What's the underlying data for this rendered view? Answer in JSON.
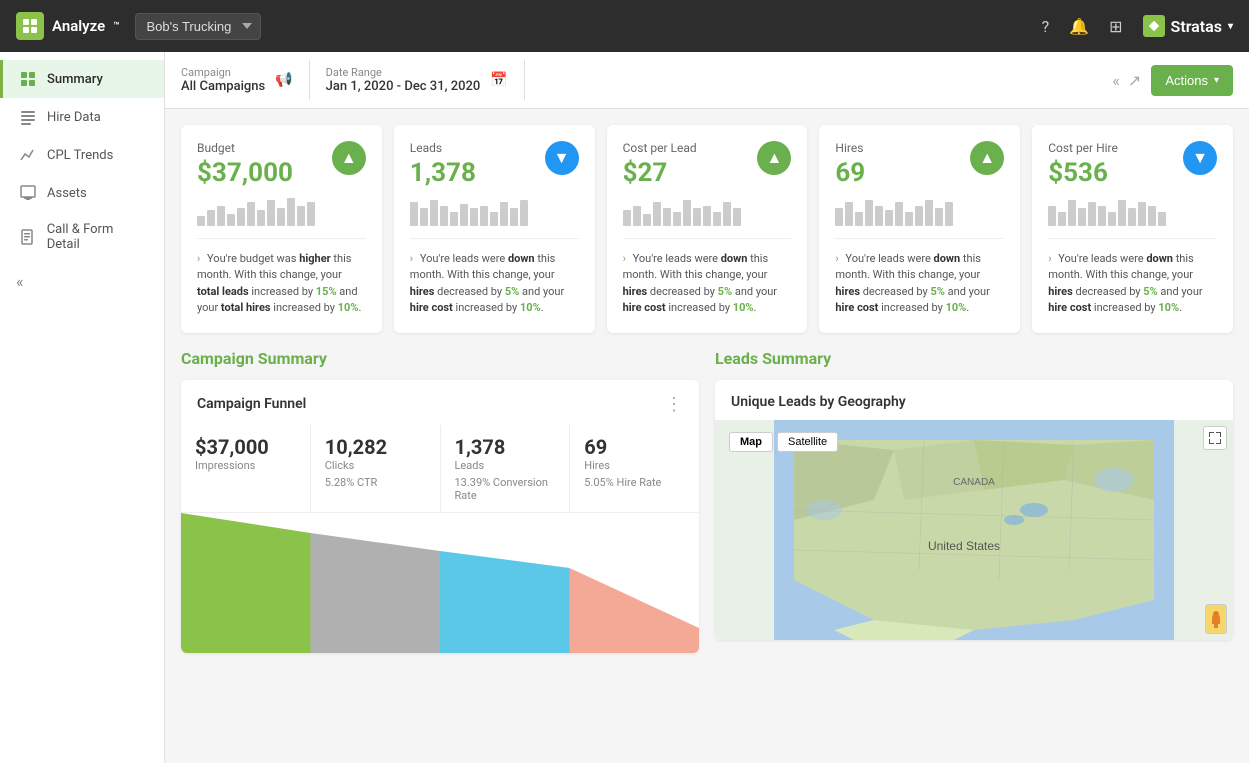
{
  "app": {
    "name": "Analyze",
    "trademark": "™"
  },
  "topnav": {
    "company": "Bob's Trucking",
    "help_icon": "?",
    "bell_icon": "🔔",
    "grid_icon": "⊞",
    "brand": "Stratas",
    "brand_chevron": "▾"
  },
  "sidebar": {
    "items": [
      {
        "id": "summary",
        "label": "Summary",
        "icon": "grid",
        "active": true
      },
      {
        "id": "hire-data",
        "label": "Hire Data",
        "icon": "table",
        "active": false
      },
      {
        "id": "cpl-trends",
        "label": "CPL Trends",
        "icon": "chart",
        "active": false
      },
      {
        "id": "assets",
        "label": "Assets",
        "icon": "image",
        "active": false
      },
      {
        "id": "call-form",
        "label": "Call & Form Detail",
        "icon": "list",
        "active": false
      }
    ],
    "collapse_label": "«"
  },
  "header": {
    "campaign_label": "Campaign",
    "campaign_value": "All Campaigns",
    "campaign_icon": "📢",
    "date_range_label": "Date Range",
    "date_range_value": "Jan 1, 2020 - Dec 31, 2020",
    "date_icon": "📅",
    "actions_label": "Actions",
    "actions_chevron": "▾"
  },
  "metrics": [
    {
      "id": "budget",
      "label": "Budget",
      "value": "$37,000",
      "direction": "up",
      "bars": [
        3,
        5,
        7,
        4,
        6,
        8,
        5,
        9,
        6,
        10,
        7,
        8
      ],
      "insight": "You're budget was higher this month. With this change, your total leads increased by 15% and your total hires increased by 10%."
    },
    {
      "id": "leads",
      "label": "Leads",
      "value": "1,378",
      "direction": "down",
      "bars": [
        8,
        6,
        9,
        7,
        5,
        8,
        6,
        7,
        5,
        8,
        6,
        9
      ],
      "insight": "You're leads were down this month. With this change, your hires decreased by 5% and your hire cost increased by 10%."
    },
    {
      "id": "cost-per-lead",
      "label": "Cost per Lead",
      "value": "$27",
      "direction": "up",
      "bars": [
        5,
        7,
        4,
        8,
        6,
        5,
        9,
        6,
        7,
        5,
        8,
        6
      ],
      "insight": "You're leads were down this month. With this change, your hires decreased by 5% and your hire cost increased by 10%."
    },
    {
      "id": "hires",
      "label": "Hires",
      "value": "69",
      "direction": "up",
      "bars": [
        6,
        8,
        5,
        9,
        7,
        6,
        8,
        5,
        7,
        9,
        6,
        8
      ],
      "insight": "You're leads were down this month. With this change, your hires decreased by 5% and your hire cost increased by 10%."
    },
    {
      "id": "cost-per-hire",
      "label": "Cost per Hire",
      "value": "$536",
      "direction": "down",
      "bars": [
        7,
        5,
        9,
        6,
        8,
        7,
        5,
        9,
        6,
        8,
        7,
        5
      ],
      "insight": "You're leads were down this month. With this change, your hires decreased by 5% and your hire cost increased by 10%."
    }
  ],
  "campaign_summary": {
    "title": "Campaign Summary",
    "funnel_title": "Campaign Funnel",
    "funnel_menu": "⋮",
    "metrics": [
      {
        "big": "$37,000",
        "label": "Impressions",
        "sub": ""
      },
      {
        "big": "10,282",
        "label": "Clicks",
        "sub": "5.28% CTR"
      },
      {
        "big": "1,378",
        "label": "Leads",
        "sub": "13.39% Conversion Rate"
      },
      {
        "big": "69",
        "label": "Hires",
        "sub": "5.05% Hire Rate"
      }
    ]
  },
  "leads_summary": {
    "title": "Leads Summary",
    "map_title": "Unique Leads by Geography",
    "map_tab_map": "Map",
    "map_tab_satellite": "Satellite"
  }
}
